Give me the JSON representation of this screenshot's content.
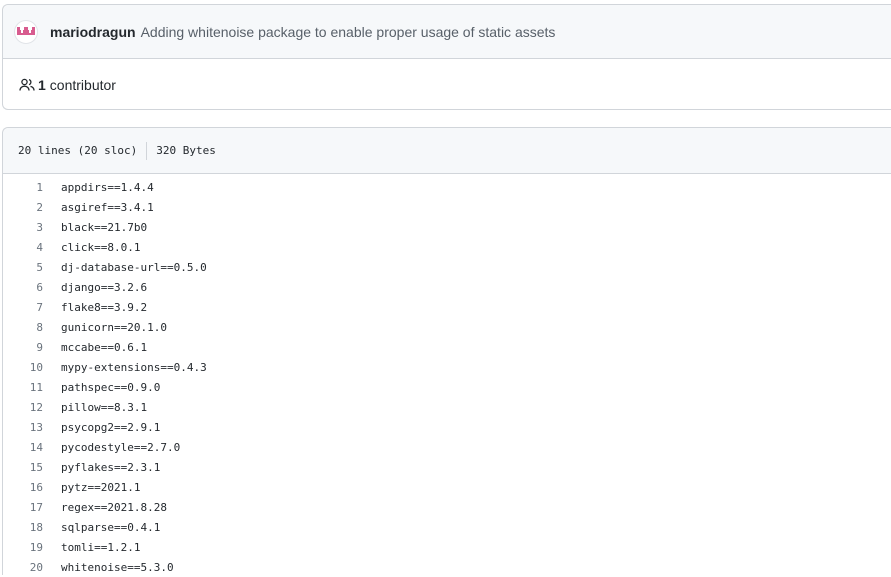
{
  "commit": {
    "author": "mariodragun",
    "message": "Adding whitenoise package to enable proper usage of static assets"
  },
  "contributors": {
    "count": "1",
    "label": "contributor"
  },
  "file": {
    "lines_info": "20 lines (20 sloc)",
    "size": "320 Bytes"
  },
  "code_lines": [
    {
      "n": "1",
      "text": "appdirs==1.4.4"
    },
    {
      "n": "2",
      "text": "asgiref==3.4.1"
    },
    {
      "n": "3",
      "text": "black==21.7b0"
    },
    {
      "n": "4",
      "text": "click==8.0.1"
    },
    {
      "n": "5",
      "text": "dj-database-url==0.5.0"
    },
    {
      "n": "6",
      "text": "django==3.2.6"
    },
    {
      "n": "7",
      "text": "flake8==3.9.2"
    },
    {
      "n": "8",
      "text": "gunicorn==20.1.0"
    },
    {
      "n": "9",
      "text": "mccabe==0.6.1"
    },
    {
      "n": "10",
      "text": "mypy-extensions==0.4.3"
    },
    {
      "n": "11",
      "text": "pathspec==0.9.0"
    },
    {
      "n": "12",
      "text": "pillow==8.3.1"
    },
    {
      "n": "13",
      "text": "psycopg2==2.9.1"
    },
    {
      "n": "14",
      "text": "pycodestyle==2.7.0"
    },
    {
      "n": "15",
      "text": "pyflakes==2.3.1"
    },
    {
      "n": "16",
      "text": "pytz==2021.1"
    },
    {
      "n": "17",
      "text": "regex==2021.8.28"
    },
    {
      "n": "18",
      "text": "sqlparse==0.4.1"
    },
    {
      "n": "19",
      "text": "tomli==1.2.1"
    },
    {
      "n": "20",
      "text": "whitenoise==5.3.0"
    }
  ]
}
